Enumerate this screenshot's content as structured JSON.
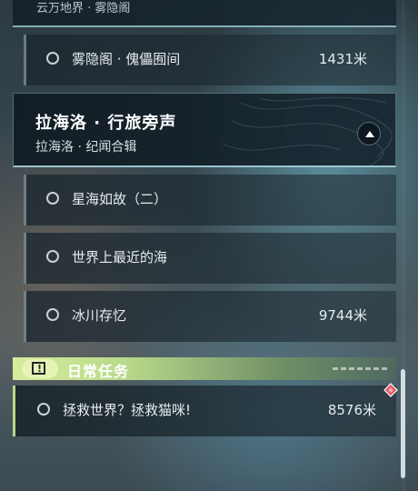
{
  "prev_chapter": {
    "subtitle": "云万地界 · 雾隐阁"
  },
  "quests": [
    {
      "name": "雾隐阁 · 傀儡囿间",
      "distance": "1431米"
    }
  ],
  "chapter": {
    "title": "拉海洛 · 行旅旁声",
    "subtitle": "拉海洛 · 纪闻合辑",
    "collapse_icon": "caret-up-icon"
  },
  "chapter_quests": [
    {
      "name": "星海如故（二）",
      "distance": ""
    },
    {
      "name": "世界上最近的海",
      "distance": ""
    },
    {
      "name": "冰川存忆",
      "distance": "9744米"
    }
  ],
  "daily": {
    "label": "日常任务",
    "icon": "alert-icon",
    "icon_glyph": "!",
    "accent": "#c8e28f",
    "quest": {
      "name": "拯救世界？拯救猫咪!",
      "distance": "8576米",
      "badge_color": "#e0575f"
    }
  }
}
